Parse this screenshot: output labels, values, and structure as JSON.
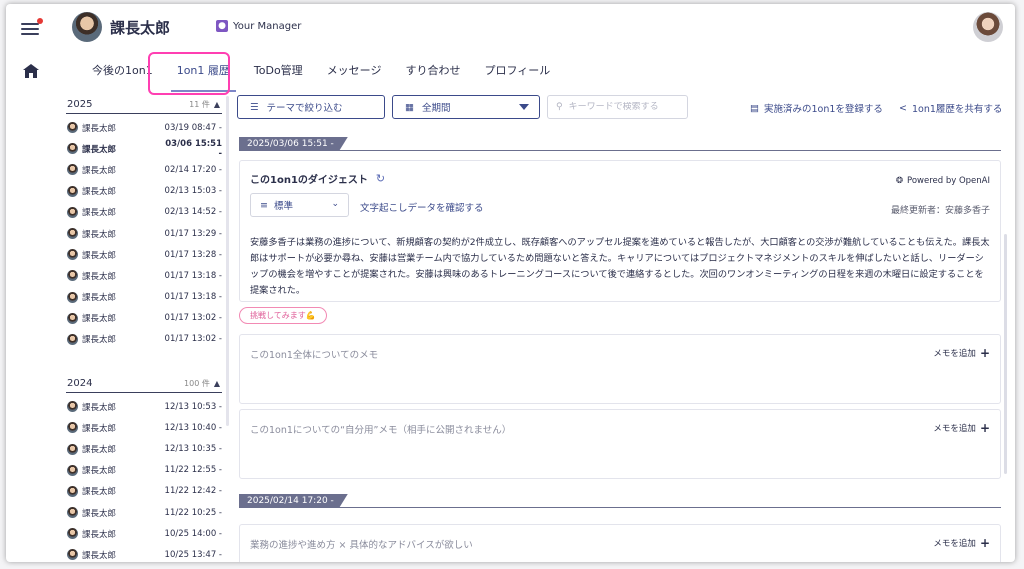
{
  "header": {
    "user_name": "課長太郎",
    "role_badge": "Your Manager"
  },
  "tabs": [
    {
      "label": "今後の1on1"
    },
    {
      "label": "1on1 履歴"
    },
    {
      "label": "ToDo管理"
    },
    {
      "label": "メッセージ"
    },
    {
      "label": "すり合わせ"
    },
    {
      "label": "プロフィール"
    }
  ],
  "sidebar": {
    "years": [
      {
        "year": "2025",
        "count": "11 件",
        "items": [
          {
            "name": "課長太郎",
            "date": "03/19 08:47 -"
          },
          {
            "name": "課長太郎",
            "date": "03/06 15:51 -"
          },
          {
            "name": "課長太郎",
            "date": "02/14 17:20 -"
          },
          {
            "name": "課長太郎",
            "date": "02/13 15:03 -"
          },
          {
            "name": "課長太郎",
            "date": "02/13 14:52 -"
          },
          {
            "name": "課長太郎",
            "date": "01/17 13:29 -"
          },
          {
            "name": "課長太郎",
            "date": "01/17 13:28 -"
          },
          {
            "name": "課長太郎",
            "date": "01/17 13:18 -"
          },
          {
            "name": "課長太郎",
            "date": "01/17 13:18 -"
          },
          {
            "name": "課長太郎",
            "date": "01/17 13:02 -"
          },
          {
            "name": "課長太郎",
            "date": "01/17 13:02 -"
          }
        ]
      },
      {
        "year": "2024",
        "count": "100 件",
        "items": [
          {
            "name": "課長太郎",
            "date": "12/13 10:53 -"
          },
          {
            "name": "課長太郎",
            "date": "12/13 10:40 -"
          },
          {
            "name": "課長太郎",
            "date": "12/13 10:35 -"
          },
          {
            "name": "課長太郎",
            "date": "11/22 12:55 -"
          },
          {
            "name": "課長太郎",
            "date": "11/22 12:42 -"
          },
          {
            "name": "課長太郎",
            "date": "11/22 10:25 -"
          },
          {
            "name": "課長太郎",
            "date": "10/25 14:00 -"
          },
          {
            "name": "課長太郎",
            "date": "10/25 13:47 -"
          }
        ]
      }
    ]
  },
  "toolbar": {
    "theme_filter": "テーマで絞り込む",
    "period": "全期間",
    "search_placeholder": "キーワードで検索する",
    "register_link": "実施済みの1on1を登録する",
    "share_link": "1on1履歴を共有する"
  },
  "session1": {
    "date": "2025/03/06 15:51 -",
    "digest_title": "この1on1のダイジェスト",
    "powered_by": "Powered by OpenAI",
    "style_select": "標準",
    "transcript_link": "文字起こしデータを確認する",
    "last_updated": "最終更新者：安藤多香子",
    "digest_text": "安藤多香子は業務の進捗について、新規顧客の契約が2件成立し、既存顧客へのアップセル提案を進めていると報告したが、大口顧客との交渉が難航していることも伝えた。課長太郎はサポートが必要か尋ね、安藤は営業チーム内で協力しているため問題ないと答えた。キャリアについてはプロジェクトマネジメントのスキルを伸ばしたいと話し、リーダーシップの機会を増やすことが提案された。安藤は興味のあるトレーニングコースについて後で連絡するとした。次回のワンオンミーティングの日程を来週の木曜日に設定することを提案された。",
    "tag": "挑戦してみます💪",
    "memo_all": "この1on1全体についてのメモ",
    "memo_private": "この1on1についての“自分用”メモ（相手に公開されません）",
    "add_memo": "メモを追加"
  },
  "session2": {
    "date": "2025/02/14 17:20 -",
    "theme": "業務の進捗や進め方 × 具体的なアドバイスが欲しい",
    "add_memo": "メモを追加"
  }
}
